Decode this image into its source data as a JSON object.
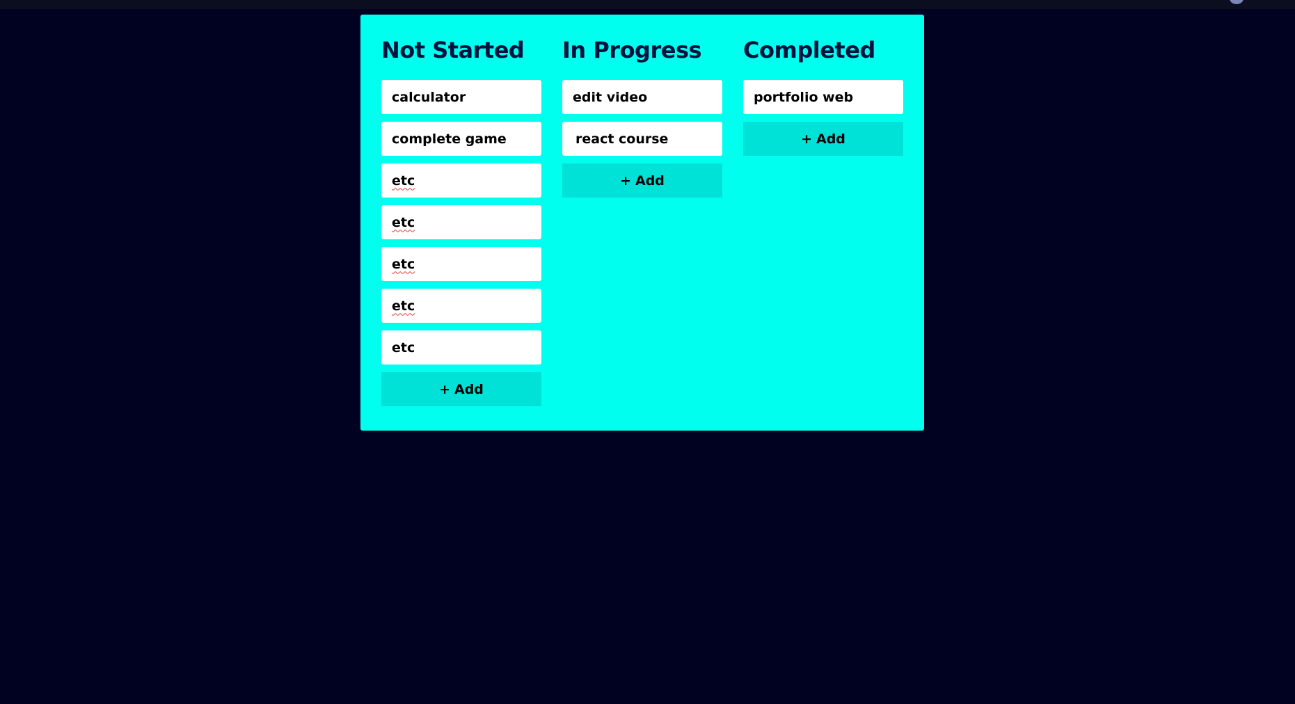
{
  "board": {
    "columns": [
      {
        "title": "Not Started",
        "cards": [
          "calculator",
          "complete game",
          "etc",
          "etc",
          "etc",
          "etc",
          "etc"
        ],
        "add_label": "Add"
      },
      {
        "title": "In Progress",
        "cards": [
          "edit video",
          "react course"
        ],
        "add_label": "Add"
      },
      {
        "title": "Completed",
        "cards": [
          "portfolio web"
        ],
        "add_label": "Add"
      }
    ]
  },
  "icons": {
    "add": "plus-icon"
  },
  "colors": {
    "background": "#010221",
    "board": "#00ffee",
    "card": "#ffffff",
    "add_button": "#00e2d8",
    "title": "#02133f"
  }
}
